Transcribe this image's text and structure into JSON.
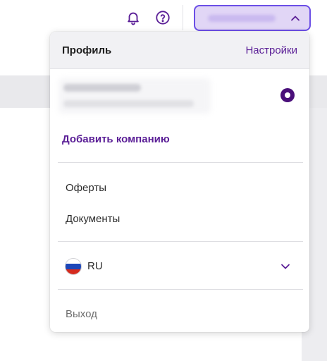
{
  "header": {
    "notifications_icon": "bell-icon",
    "help_icon": "question-circle-icon",
    "account_chevron_icon": "chevron-up-icon"
  },
  "dropdown": {
    "title": "Профиль",
    "settings_link": "Настройки",
    "selected_company": true,
    "add_company_label": "Добавить компанию",
    "menu_items": [
      "Оферты",
      "Документы"
    ],
    "language": {
      "flag_icon": "russia-flag-icon",
      "code": "RU",
      "chevron_icon": "chevron-down-icon"
    },
    "logout_label": "Выход"
  },
  "colors": {
    "accent": "#5a1e96",
    "account_button_bg": "#e1d6f6",
    "account_button_border": "#6b4ee6",
    "header_bg": "#f1f1f4"
  }
}
